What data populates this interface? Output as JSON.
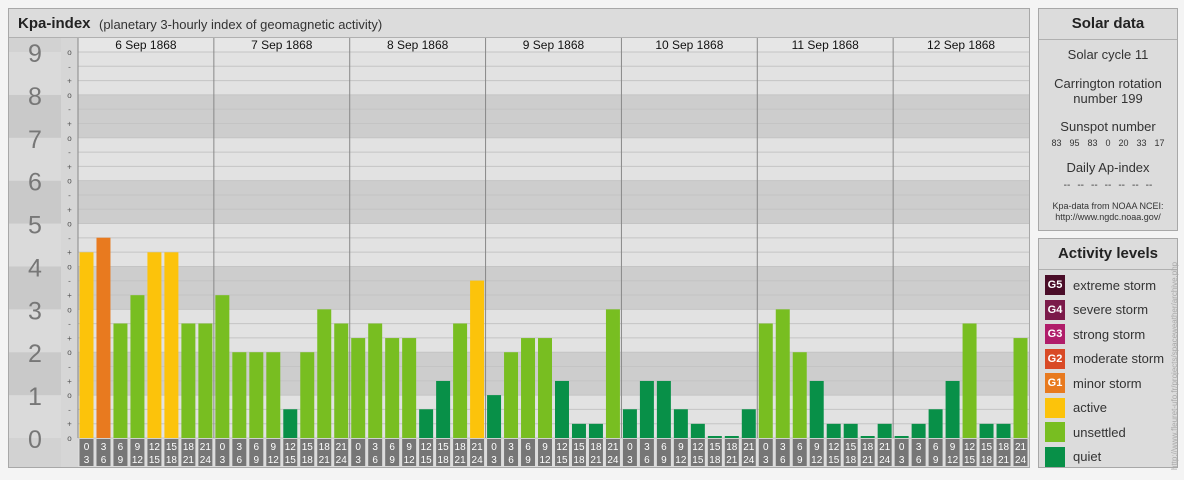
{
  "header": {
    "title": "Kpa-index",
    "subtitle": "(planetary 3-hourly index of geomagnetic activity)"
  },
  "chart_data": {
    "type": "bar",
    "ylim": [
      0,
      9
    ],
    "y_ticks": [
      "0",
      "1",
      "2",
      "3",
      "4",
      "5",
      "6",
      "7",
      "8",
      "9"
    ],
    "sub_ticks": [
      "o",
      "+",
      "-"
    ],
    "days": [
      "6 Sep 1868",
      "7 Sep 1868",
      "8 Sep 1868",
      "9 Sep 1868",
      "10 Sep 1868",
      "11 Sep 1868",
      "12 Sep 1868"
    ],
    "interval_labels": [
      [
        "0",
        "3"
      ],
      [
        "3",
        "6"
      ],
      [
        "6",
        "9"
      ],
      [
        "9",
        "12"
      ],
      [
        "12",
        "15"
      ],
      [
        "15",
        "18"
      ],
      [
        "18",
        "21"
      ],
      [
        "21",
        "24"
      ]
    ],
    "values": [
      4.33,
      4.67,
      2.67,
      3.33,
      4.33,
      4.33,
      2.67,
      2.67,
      3.33,
      2.0,
      2.0,
      2.0,
      0.67,
      2.0,
      3.0,
      2.67,
      2.33,
      2.67,
      2.33,
      2.33,
      0.67,
      1.33,
      2.67,
      3.67,
      1.0,
      2.0,
      2.33,
      2.33,
      1.33,
      0.33,
      0.33,
      3.0,
      0.67,
      1.33,
      1.33,
      0.67,
      0.33,
      0.0,
      0.0,
      0.67,
      2.67,
      3.0,
      2.0,
      1.33,
      0.33,
      0.33,
      0.0,
      0.33,
      0.0,
      0.33,
      0.67,
      1.33,
      2.67,
      0.33,
      0.33,
      2.33
    ],
    "level_colors": {
      "quiet": "#089048",
      "unsettled": "#78be21",
      "active": "#fcc30b",
      "minor": "#e87a1f"
    }
  },
  "solar": {
    "title": "Solar data",
    "cycle": "Solar cycle 11",
    "carrington_1": "Carrington rotation",
    "carrington_2": "number 199",
    "sunspot_title": "Sunspot number",
    "sunspot_values": [
      "83",
      "95",
      "83",
      "0",
      "20",
      "33",
      "17"
    ],
    "ap_title": "Daily Ap-index",
    "ap_values": [
      "--",
      "--",
      "--",
      "--",
      "--",
      "--",
      "--"
    ],
    "note_1": "Kpa-data from NOAA NCEI:",
    "note_2": "http://www.ngdc.noaa.gov/"
  },
  "activity": {
    "title": "Activity levels",
    "items": [
      {
        "code": "G5",
        "label": "extreme storm",
        "color": "#4a0d28"
      },
      {
        "code": "G4",
        "label": "severe storm",
        "color": "#7b1a4a"
      },
      {
        "code": "G3",
        "label": "strong storm",
        "color": "#b01d6a"
      },
      {
        "code": "G2",
        "label": "moderate storm",
        "color": "#d94a26"
      },
      {
        "code": "G1",
        "label": "minor storm",
        "color": "#e87a1f"
      },
      {
        "code": "",
        "label": "active",
        "color": "#fcc30b"
      },
      {
        "code": "",
        "label": "unsettled",
        "color": "#78be21"
      },
      {
        "code": "",
        "label": "quiet",
        "color": "#089048"
      }
    ]
  },
  "watermark": "http://www.fleuret-ufo.fr/projects/spaceweather/archive.php"
}
